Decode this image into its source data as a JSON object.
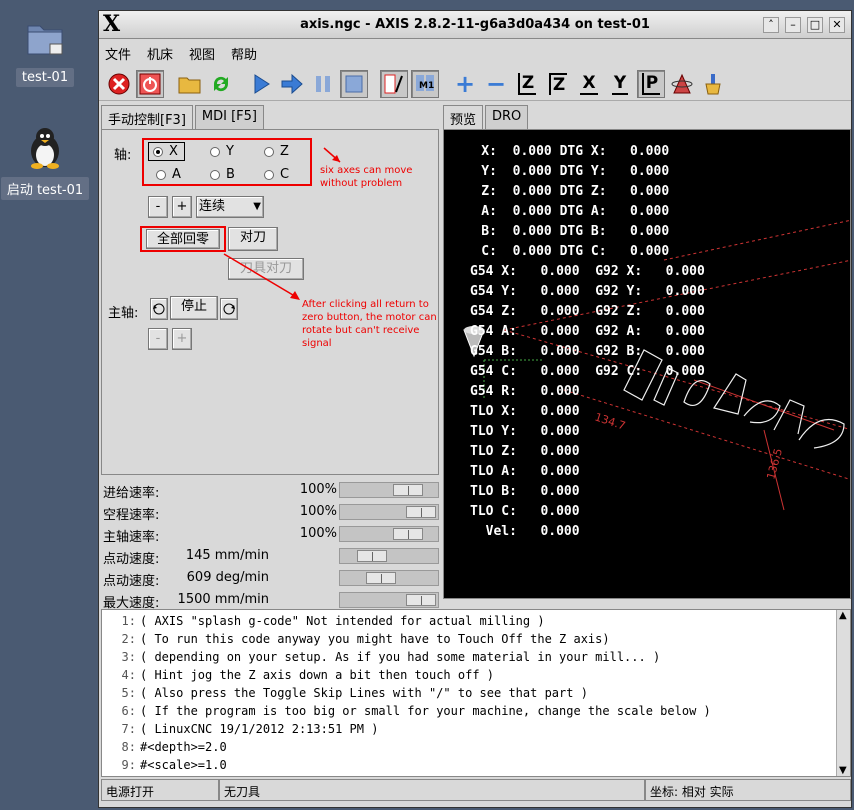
{
  "desktop": {
    "icons": [
      {
        "label": "test-01"
      },
      {
        "label": "启动 test-01"
      }
    ]
  },
  "window": {
    "title": "axis.ngc - AXIS 2.8.2-11-g6a3d0a434 on test-01",
    "logo": "X"
  },
  "menu": [
    "文件",
    "机床",
    "视图",
    "帮助"
  ],
  "toolbar": {
    "icons": [
      "estop-icon",
      "power-icon",
      "open-file-icon",
      "reload-icon",
      "run-icon",
      "step-icon",
      "pause-icon",
      "stop-icon",
      "skip-lines-icon",
      "optional-stop-icon",
      "zoom-in-icon",
      "zoom-out-icon",
      "view-z-icon",
      "view-z2-icon",
      "view-x-icon",
      "view-y-icon",
      "view-p-icon",
      "rotate-icon",
      "clear-backplot-icon"
    ],
    "view_labels": [
      "Z",
      "Z",
      "X",
      "Y",
      "P"
    ]
  },
  "left_tabs": [
    "手动控制[F3]",
    "MDI [F5]"
  ],
  "manual": {
    "axis_label": "轴:",
    "axes": [
      "X",
      "Y",
      "Z",
      "A",
      "B",
      "C"
    ],
    "selected_axis": "X",
    "minus": "-",
    "plus": "+",
    "jog_mode": "连续",
    "home_all": "全部回零",
    "touch_off": "对刀",
    "tool_touch_off": "刀具对刀",
    "spindle_label": "主轴:",
    "spindle_stop": "停止",
    "spindle_minus": "-",
    "spindle_plus": "+"
  },
  "annotations": {
    "axes_note": "six axes can move without problem",
    "home_note": "After clicking all return to zero button, the motor can rotate but can't receive signal"
  },
  "sliders": [
    {
      "label": "进给速率:",
      "value": "100%",
      "level": 0.8
    },
    {
      "label": "空程速率:",
      "value": "100%",
      "level": 1.0
    },
    {
      "label": "主轴速率:",
      "value": "100%",
      "level": 0.8
    },
    {
      "label": "点动速度:",
      "value": "145 mm/min",
      "level": 0.25
    },
    {
      "label": "点动速度:",
      "value": "609 deg/min",
      "level": 0.4
    },
    {
      "label": "最大速度:",
      "value": "1500 mm/min",
      "level": 1.0
    }
  ],
  "right_tabs": [
    "预览",
    "DRO"
  ],
  "dro": [
    "    X:  0.000 DTG X:   0.000",
    "    Y:  0.000 DTG Y:   0.000",
    "    Z:  0.000 DTG Z:   0.000",
    "    A:  0.000 DTG A:   0.000",
    "    B:  0.000 DTG B:   0.000",
    "    C:  0.000 DTG C:   0.000",
    "G54 X:   0.000  G92 X:   0.000",
    "G54 Y:   0.000  G92 Y:   0.000",
    "G54 Z:   0.000  G92 Z:   0.000",
    "G54 A:   0.000  G92 A:   0.000",
    "G54 B:   0.000  G92 B:   0.000",
    "G54 C:   0.000  G92 C:   0.000",
    "G54 R:   0.000",
    "TLO X:   0.000",
    "TLO Y:   0.000",
    "TLO Z:   0.000",
    "TLO A:   0.000",
    "TLO B:   0.000",
    "TLO C:   0.000",
    "  Vel:   0.000"
  ],
  "preview": {
    "dim_a": "134.7",
    "dim_b": "136.5"
  },
  "gcode": [
    {
      "n": "1:",
      "text": "( AXIS \"splash g-code\" Not intended for actual milling )"
    },
    {
      "n": "2:",
      "text": "( To run this code anyway you might have to Touch Off the Z axis)"
    },
    {
      "n": "3:",
      "text": "( depending on your setup. As if you had some material in your mill... )"
    },
    {
      "n": "4:",
      "text": "( Hint jog the Z axis down a bit then touch off )"
    },
    {
      "n": "5:",
      "text": "( Also press the Toggle Skip Lines with \"/\" to see that part )"
    },
    {
      "n": "6:",
      "text": "( If the program is too big or small for your machine, change the scale below )"
    },
    {
      "n": "7:",
      "text": "( LinuxCNC 19/1/2012 2:13:51 PM )"
    },
    {
      "n": "8:",
      "text": "#<depth>=2.0"
    },
    {
      "n": "9:",
      "text": "#<scale>=1.0"
    }
  ],
  "status": {
    "machine": "电源打开",
    "tool": "无刀具",
    "coords": "坐标: 相对 实际"
  }
}
